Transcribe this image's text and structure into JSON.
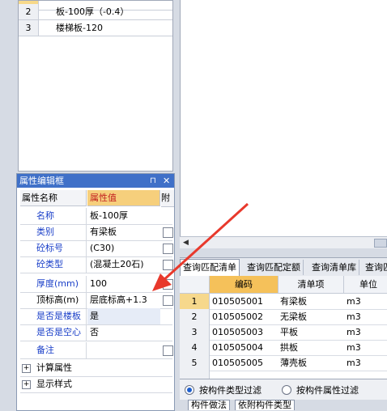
{
  "top_list": {
    "rows": [
      {
        "num": "2",
        "text": "板-100厚（-0.4）"
      },
      {
        "num": "3",
        "text": "楼梯板-120"
      }
    ]
  },
  "property_panel": {
    "title": "属性编辑框",
    "pin_icon": "pin-icon",
    "close_icon": "close-icon",
    "header": {
      "name": "属性名称",
      "value": "属性值",
      "attach": "附"
    },
    "rows": [
      {
        "name": "名称",
        "value": "板-100厚",
        "checkbox": false
      },
      {
        "name": "类别",
        "value": "有梁板",
        "checkbox": true
      },
      {
        "name": "砼标号",
        "value": "(C30)",
        "checkbox": true
      },
      {
        "name": "砼类型",
        "value": "(混凝土20石)",
        "checkbox": true
      },
      {
        "name": "厚度(mm)",
        "value": "100",
        "checkbox": true
      },
      {
        "name": "顶标高(m)",
        "value": "层底标高+1.3",
        "checkbox": true
      },
      {
        "name": "是否是楼板",
        "value": "是",
        "checkbox": false
      },
      {
        "name": "是否是空心",
        "value": "否",
        "checkbox": false
      },
      {
        "name": "备注",
        "value": "",
        "checkbox": true
      }
    ],
    "groups": [
      {
        "label": "计算属性"
      },
      {
        "label": "显示样式"
      }
    ]
  },
  "query_panel": {
    "tabs": [
      "查询匹配清单",
      "查询匹配定额",
      "查询清单库",
      "查询匹"
    ],
    "columns": [
      "编码",
      "清单项",
      "单位"
    ],
    "rows": [
      {
        "num": "1",
        "code": "010505001",
        "item": "有梁板",
        "unit": "m3"
      },
      {
        "num": "2",
        "code": "010505002",
        "item": "无梁板",
        "unit": "m3"
      },
      {
        "num": "3",
        "code": "010505003",
        "item": "平板",
        "unit": "m3"
      },
      {
        "num": "4",
        "code": "010505004",
        "item": "拱板",
        "unit": "m3"
      },
      {
        "num": "5",
        "code": "010505005",
        "item": "薄壳板",
        "unit": "m3"
      }
    ],
    "filters": [
      "按构件类型过滤",
      "按构件属性过滤"
    ],
    "bottom_tabs": [
      "构件做法",
      "依附构件类型"
    ]
  },
  "colors": {
    "accent": "#3f70c8",
    "selection": "#f5c15a",
    "arrow": "#e8392c"
  }
}
